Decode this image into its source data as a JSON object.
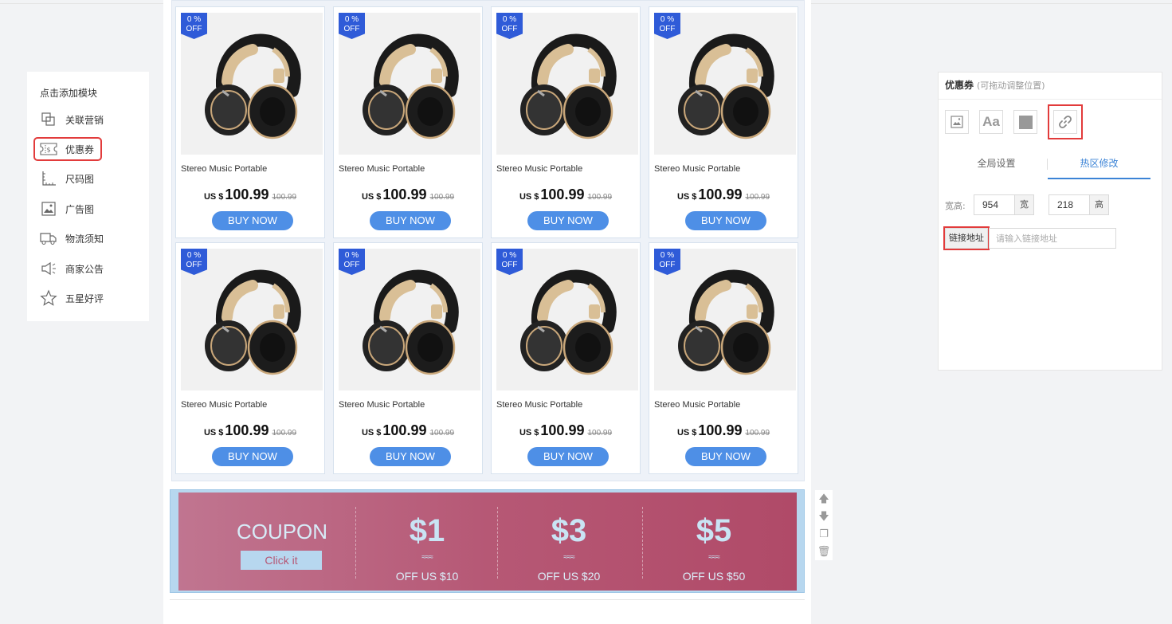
{
  "left_panel": {
    "title": "点击添加模块",
    "items": [
      {
        "label": "关联营销",
        "icon": "related-products-icon"
      },
      {
        "label": "优惠券",
        "icon": "coupon-icon"
      },
      {
        "label": "尺码图",
        "icon": "ruler-icon"
      },
      {
        "label": "广告图",
        "icon": "image-ad-icon"
      },
      {
        "label": "物流须知",
        "icon": "truck-icon"
      },
      {
        "label": "商家公告",
        "icon": "megaphone-icon"
      },
      {
        "label": "五星好评",
        "icon": "star-icon"
      }
    ],
    "selected_item": "优惠券"
  },
  "products": [
    {
      "badge_top": "0 %",
      "badge_bottom": "OFF",
      "name": "Stereo Music Portable",
      "currency": "US $",
      "price": "100.99",
      "old_price": "100.99",
      "button": "BUY NOW"
    },
    {
      "badge_top": "0 %",
      "badge_bottom": "OFF",
      "name": "Stereo Music Portable",
      "currency": "US $",
      "price": "100.99",
      "old_price": "100.99",
      "button": "BUY NOW"
    },
    {
      "badge_top": "0 %",
      "badge_bottom": "OFF",
      "name": "Stereo Music Portable",
      "currency": "US $",
      "price": "100.99",
      "old_price": "100.99",
      "button": "BUY NOW"
    },
    {
      "badge_top": "0 %",
      "badge_bottom": "OFF",
      "name": "Stereo Music Portable",
      "currency": "US $",
      "price": "100.99",
      "old_price": "100.99",
      "button": "BUY NOW"
    },
    {
      "badge_top": "0 %",
      "badge_bottom": "OFF",
      "name": "Stereo Music Portable",
      "currency": "US $",
      "price": "100.99",
      "old_price": "100.99",
      "button": "BUY NOW"
    },
    {
      "badge_top": "0 %",
      "badge_bottom": "OFF",
      "name": "Stereo Music Portable",
      "currency": "US $",
      "price": "100.99",
      "old_price": "100.99",
      "button": "BUY NOW"
    },
    {
      "badge_top": "0 %",
      "badge_bottom": "OFF",
      "name": "Stereo Music Portable",
      "currency": "US $",
      "price": "100.99",
      "old_price": "100.99",
      "button": "BUY NOW"
    },
    {
      "badge_top": "0 %",
      "badge_bottom": "OFF",
      "name": "Stereo Music Portable",
      "currency": "US $",
      "price": "100.99",
      "old_price": "100.99",
      "button": "BUY NOW"
    }
  ],
  "coupon": {
    "title": "COUPON",
    "click_label": "Click it",
    "offers": [
      {
        "amount": "$1",
        "wave": "≈≈≈",
        "label": "OFF US $10"
      },
      {
        "amount": "$3",
        "wave": "≈≈≈",
        "label": "OFF US $20"
      },
      {
        "amount": "$5",
        "wave": "≈≈≈",
        "label": "OFF US $50"
      }
    ],
    "colors": {
      "start": "#c07590",
      "end": "#b04a68",
      "frame": "#b7d7ef"
    }
  },
  "tools": {
    "up": "🡅",
    "down": "🡇",
    "copy": "❐",
    "delete": "🗑"
  },
  "right_panel": {
    "title": "优惠券",
    "subtitle": "(可拖动调整位置)",
    "icons": [
      "image-icon",
      "text-icon",
      "block-icon",
      "link-icon"
    ],
    "text_icon_label": "Aa",
    "tabs": [
      "全局设置",
      "热区修改"
    ],
    "active_tab": "热区修改",
    "size_label": "宽高:",
    "width_value": "954",
    "width_unit": "宽",
    "height_value": "218",
    "height_unit": "高",
    "link_label": "链接地址",
    "link_placeholder": "请输入链接地址",
    "link_value": ""
  },
  "colors": {
    "accent": "#3b83d6",
    "buy_button": "#4e8fe6",
    "badge": "#2f5bd8",
    "highlight": "#e23b3b"
  }
}
